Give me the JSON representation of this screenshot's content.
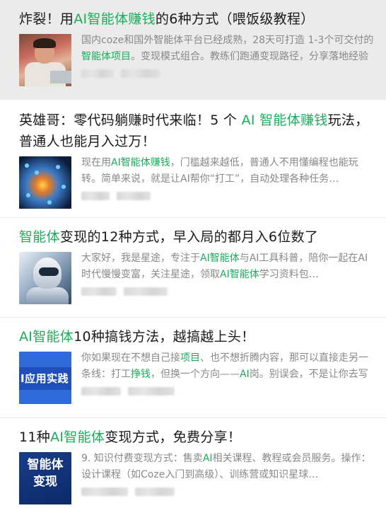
{
  "results": [
    {
      "title": [
        {
          "t": "炸裂！用",
          "hl": false
        },
        {
          "t": "AI智能体赚钱",
          "hl": true
        },
        {
          "t": "的6种方式（喂饭级教程）",
          "hl": false
        }
      ],
      "snippet": [
        {
          "t": "国内coze和国外智能体平台已经成熟，28天可打造 1-3个可交付的",
          "hl": false
        },
        {
          "t": "智能体项目",
          "hl": true
        },
        {
          "t": "。变现模式组合。教练们跑通变现路径，分享落地经验与避坑指南",
          "hl": false
        }
      ],
      "thumb_icon": "person-with-laptop-image",
      "active": true
    },
    {
      "title": [
        {
          "t": "英雄哥：零代码躺赚时代来临！5 个 ",
          "hl": false
        },
        {
          "t": "AI 智能体赚钱",
          "hl": true
        },
        {
          "t": "玩法，普通人也能月入过万！",
          "hl": false
        }
      ],
      "snippet": [
        {
          "t": "现在用",
          "hl": false
        },
        {
          "t": "AI智能体赚钱",
          "hl": true
        },
        {
          "t": "，门槛越来越低，普通人不用懂编程也能玩转。简单来说，就是让AI帮你“打工”，自动处理各种任务…",
          "hl": false
        }
      ],
      "thumb_icon": "network-globe-image",
      "active": false
    },
    {
      "title": [
        {
          "t": "智能体",
          "hl": true
        },
        {
          "t": "变现的12种方式，早入局的都月入6位数了",
          "hl": false
        }
      ],
      "snippet": [
        {
          "t": "大家好，我是星途，专注于",
          "hl": false
        },
        {
          "t": "AI智能体",
          "hl": true
        },
        {
          "t": "与AI工具科普，陪你一起在AI时代慢慢变富，关注星途，领取",
          "hl": false
        },
        {
          "t": "AI智能体",
          "hl": true
        },
        {
          "t": "学习资料包…",
          "hl": false
        }
      ],
      "thumb_icon": "robot-image",
      "active": false
    },
    {
      "title": [
        {
          "t": "AI智能体",
          "hl": true
        },
        {
          "t": "10种搞钱方法，越搞越上头！",
          "hl": false
        }
      ],
      "snippet": [
        {
          "t": "你如果现在不想自己接",
          "hl": false
        },
        {
          "t": "项目",
          "hl": true
        },
        {
          "t": "、也不想折腾内容，那可以直接走另一条线：打工",
          "hl": false
        },
        {
          "t": "挣钱",
          "hl": true
        },
        {
          "t": "，但换一个方向——",
          "hl": false
        },
        {
          "t": "AI",
          "hl": true
        },
        {
          "t": "岗。别误会，不是让你去写代码…",
          "hl": false
        }
      ],
      "thumb_icon": "ai-application-banner-image",
      "thumb_text": "I应用实践",
      "active": false
    },
    {
      "title": [
        {
          "t": "11种",
          "hl": false
        },
        {
          "t": "AI智能体",
          "hl": true
        },
        {
          "t": "变现方式，免费分享！",
          "hl": false
        }
      ],
      "snippet": [
        {
          "t": "9. 知识付费变现方式：售卖",
          "hl": false
        },
        {
          "t": "AI",
          "hl": true
        },
        {
          "t": "相关课程、教程或会员服务。操作：设计课程（如Coze入门到高级）、训练营或知识星球…",
          "hl": false
        }
      ],
      "thumb_icon": "agent-monetization-cover-image",
      "thumb_text": "智能体变现",
      "active": false
    }
  ]
}
